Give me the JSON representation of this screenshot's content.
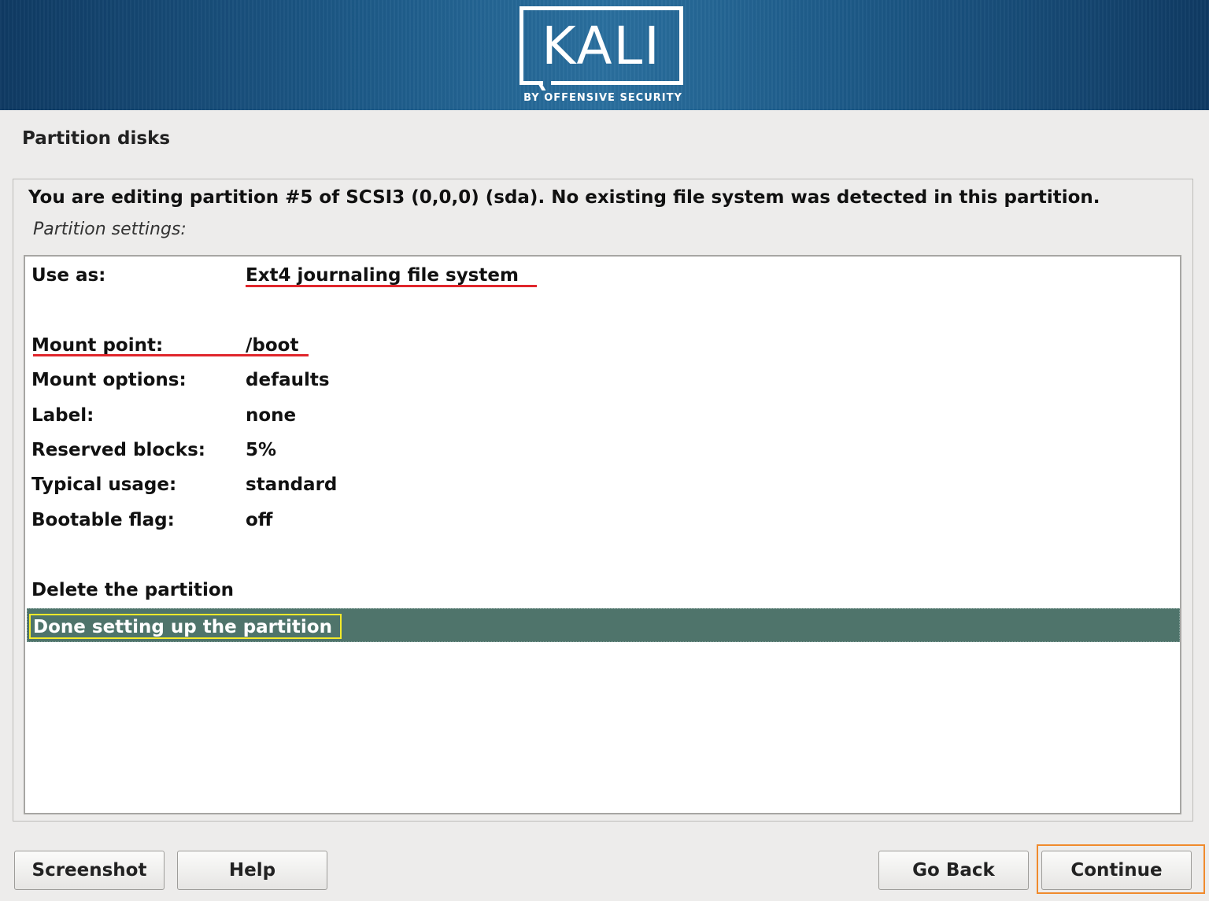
{
  "header": {
    "logo_text": "KALI",
    "logo_subtitle": "BY OFFENSIVE SECURITY"
  },
  "page": {
    "title": "Partition disks"
  },
  "dialog": {
    "description": "You are editing partition #5 of SCSI3 (0,0,0) (sda). No existing file system was detected in this partition.",
    "subtitle": "Partition settings:",
    "settings": [
      {
        "key": "Use as:",
        "value": "Ext4 journaling file system"
      },
      {
        "key": "Mount point:",
        "value": "/boot"
      },
      {
        "key": "Mount options:",
        "value": "defaults"
      },
      {
        "key": "Label:",
        "value": "none"
      },
      {
        "key": "Reserved blocks:",
        "value": "5%"
      },
      {
        "key": "Typical usage:",
        "value": "standard"
      },
      {
        "key": "Bootable flag:",
        "value": "off"
      }
    ],
    "actions": [
      {
        "label": "Delete the partition"
      },
      {
        "label": "Done setting up the partition",
        "selected": true
      }
    ]
  },
  "buttons": {
    "screenshot": "Screenshot",
    "help": "Help",
    "go_back": "Go Back",
    "continue": "Continue"
  },
  "colors": {
    "selection_bg": "#4f746b",
    "selection_outline": "#f3ea2a",
    "annotation_red": "#e0262c",
    "annotation_orange": "#f08a2c"
  }
}
